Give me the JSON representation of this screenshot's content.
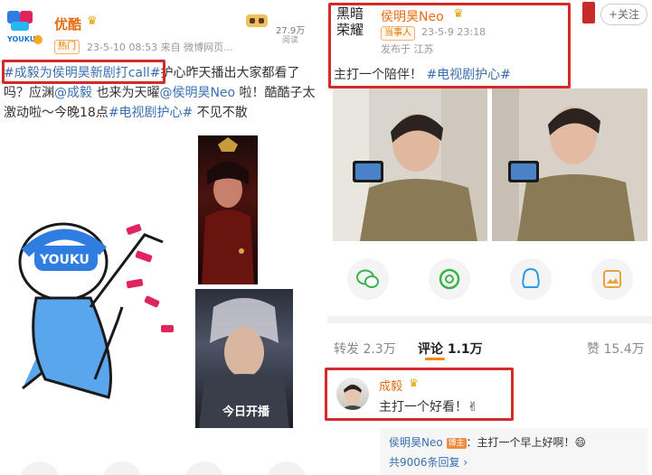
{
  "left_post": {
    "author": "优酷",
    "crown": "♛",
    "logo_text": "YOUKU",
    "hot_tag": "热门",
    "meta": "23-5-10 08:53  来自 微博网页...",
    "views_count": "27.9万",
    "views_label": "阅读",
    "hashtag_highlight": "#成毅为侯明昊新剧打call#",
    "text_part1": "护心昨天播出大家都看了吗？应渊",
    "mention1": "@成毅",
    "text_part2": " 也来为天曜",
    "mention2": "@侯明昊Neo",
    "text_part3": " 啦！酷酷子太激动啦～今晚18点",
    "hashtag2": "#电视剧护心#",
    "text_part4": " 不见不散",
    "mascot_label": "YOUKU",
    "poster2_caption": "今日开播"
  },
  "right_post": {
    "logo_line1": "黑暗",
    "logo_line2": "荣耀",
    "author": "侯明昊Neo",
    "crown": "♛",
    "tag": "当事人",
    "date": "23-5-9 23:18",
    "location": "发布于 江苏",
    "follow_label": "+关注",
    "text": "主打一个陪伴！",
    "hashtag": "#电视剧护心#"
  },
  "tabs": {
    "repost": "转发 2.3万",
    "comment": "评论 1.1万",
    "like": "赞 15.4万"
  },
  "comment": {
    "name": "成毅",
    "crown": "♛",
    "text": "主打一个好看！✌"
  },
  "reply": {
    "name": "侯明昊Neo",
    "tag": "博主",
    "text": "：主打一个早上好啊！😄",
    "more": "共9006条回复 ›"
  },
  "colors": {
    "accent_orange": "#ff8200",
    "link_blue": "#3a6fb0",
    "highlight_red": "#d42a2a"
  }
}
